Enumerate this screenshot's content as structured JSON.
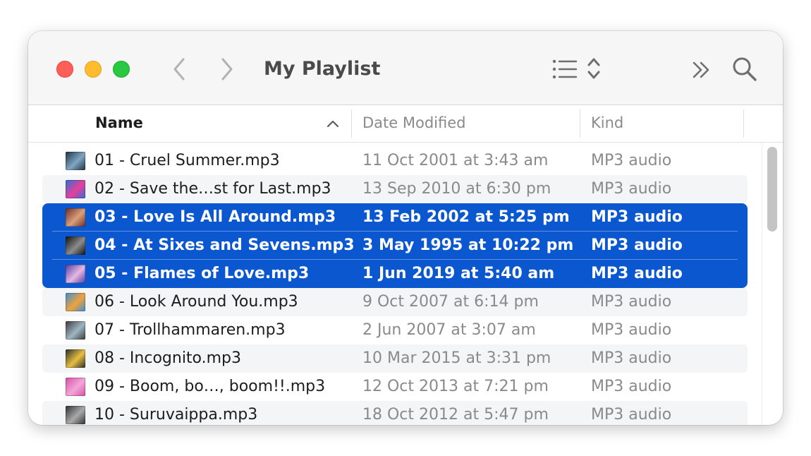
{
  "window": {
    "title": "My Playlist"
  },
  "toolbar": {
    "back_icon": "chevron-left-icon",
    "forward_icon": "chevron-right-icon",
    "view_icon": "list-view-icon",
    "sort_toggle_icon": "up-down-chevron-icon",
    "more_icon": "double-chevron-right-icon",
    "search_icon": "magnifying-glass-icon"
  },
  "columns": {
    "name": "Name",
    "date": "Date Modified",
    "kind": "Kind"
  },
  "colors": {
    "selection": "#0b57d0",
    "close": "#ff5f57",
    "minimize": "#febc2e",
    "zoom": "#28c840"
  },
  "files": [
    {
      "name": "01 - Cruel Summer.mp3",
      "date": "11 Oct 2001 at 3:43 am",
      "kind": "MP3 audio",
      "selected": false,
      "art": [
        "#1f3140",
        "#7fa6c4"
      ]
    },
    {
      "name": "02 - Save the…st for Last.mp3",
      "date": "13 Sep 2010 at 6:30 pm",
      "kind": "MP3 audio",
      "selected": false,
      "art": [
        "#2d6fd8",
        "#e8409a"
      ]
    },
    {
      "name": "03 - Love Is All Around.mp3",
      "date": "13 Feb 2002 at 5:25 pm",
      "kind": "MP3 audio",
      "selected": true,
      "art": [
        "#6d2c2c",
        "#d9a07a"
      ]
    },
    {
      "name": "04 - At Sixes and Sevens.mp3",
      "date": "3 May 1995 at 10:22 pm",
      "kind": "MP3 audio",
      "selected": true,
      "art": [
        "#101010",
        "#8c8c8c"
      ]
    },
    {
      "name": "05 - Flames of Love.mp3",
      "date": "1 Jun 2019 at 5:40 am",
      "kind": "MP3 audio",
      "selected": true,
      "art": [
        "#4d3fa8",
        "#e7b7e0"
      ]
    },
    {
      "name": "06 - Look Around You.mp3",
      "date": "9 Oct 2007 at 6:14 pm",
      "kind": "MP3 audio",
      "selected": false,
      "art": [
        "#3c8ed8",
        "#f0a23a"
      ]
    },
    {
      "name": "07 - Trollhammaren.mp3",
      "date": "2 Jun 2007 at 3:07 am",
      "kind": "MP3 audio",
      "selected": false,
      "art": [
        "#3a3a3a",
        "#9fb5c4"
      ]
    },
    {
      "name": "08 - Incognito.mp3",
      "date": "10 Mar 2015 at 3:31 pm",
      "kind": "MP3 audio",
      "selected": false,
      "art": [
        "#2a2a2a",
        "#e8c040"
      ]
    },
    {
      "name": "09 - Boom, bo…, boom!!.mp3",
      "date": "12 Oct 2013 at 7:21 pm",
      "kind": "MP3 audio",
      "selected": false,
      "art": [
        "#d94da8",
        "#f2a7d8"
      ]
    },
    {
      "name": "10 - Suruvaippa.mp3",
      "date": "18 Oct 2012 at 5:47 pm",
      "kind": "MP3 audio",
      "selected": false,
      "art": [
        "#303030",
        "#a9a9a9"
      ]
    }
  ]
}
